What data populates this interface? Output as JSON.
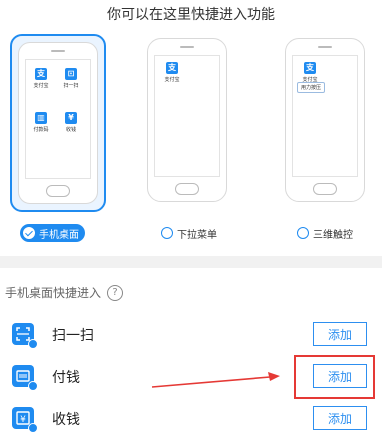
{
  "headline": "你可以在这里快捷进入功能",
  "phones": [
    {
      "apps": [
        {
          "label": "支付宝",
          "glyph": "支"
        },
        {
          "label": "扫一扫",
          "glyph": "⊡"
        },
        {
          "label": "付款码",
          "glyph": "▥"
        },
        {
          "label": "收钱",
          "glyph": "¥"
        }
      ]
    },
    {
      "apps": [
        {
          "label": "支付宝",
          "glyph": "支"
        }
      ]
    },
    {
      "apps": [
        {
          "label": "支付宝",
          "glyph": "支"
        }
      ],
      "press_label": "用力按压"
    }
  ],
  "options": [
    {
      "label": "手机桌面",
      "selected": true
    },
    {
      "label": "下拉菜单",
      "selected": false
    },
    {
      "label": "三维触控",
      "selected": false
    }
  ],
  "section": {
    "title": "手机桌面快捷进入",
    "help": "?"
  },
  "shortcuts": [
    {
      "label": "扫一扫",
      "icon": "scan-icon",
      "button": "添加"
    },
    {
      "label": "付钱",
      "icon": "payment-code-icon",
      "button": "添加"
    },
    {
      "label": "收钱",
      "icon": "collect-money-icon",
      "button": "添加"
    }
  ],
  "colors": {
    "accent": "#1f8bf0",
    "annotation": "#e53935",
    "divider": "#f1f1f1"
  }
}
